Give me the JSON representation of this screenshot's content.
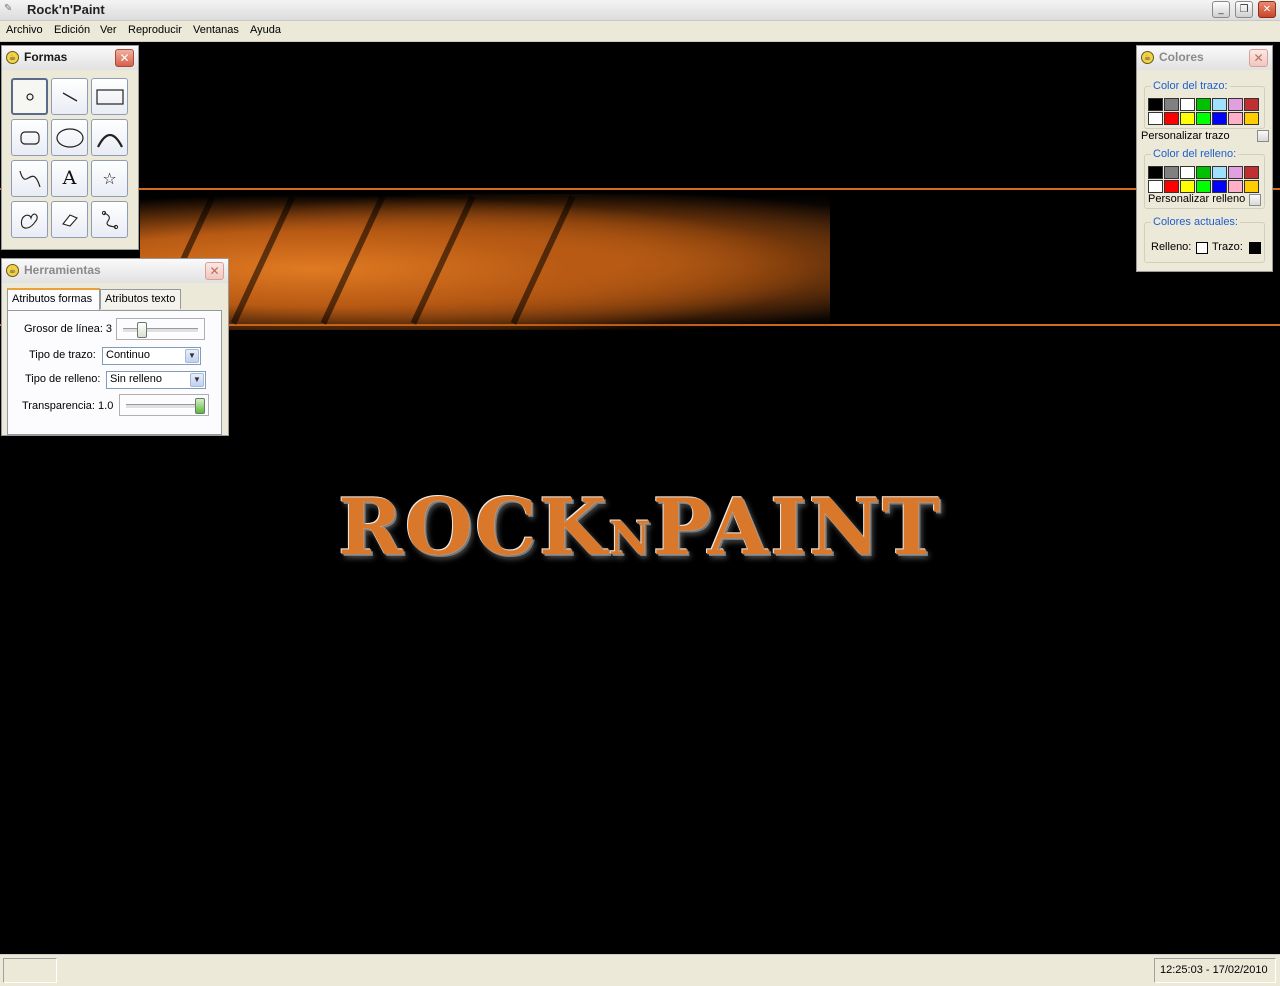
{
  "window": {
    "title": "Rock'n'Paint"
  },
  "menu": [
    "Archivo",
    "Edición",
    "Ver",
    "Reproducir",
    "Ventanas",
    "Ayuda"
  ],
  "logo": {
    "text_main_1": "ROCK",
    "text_small": "N",
    "text_main_2": "PAINT"
  },
  "formas": {
    "title": "Formas",
    "tools": [
      {
        "name": "point-tool",
        "glyph": "•"
      },
      {
        "name": "line-tool",
        "glyph": ""
      },
      {
        "name": "rectangle-tool",
        "glyph": ""
      },
      {
        "name": "rounded-rectangle-tool",
        "glyph": ""
      },
      {
        "name": "ellipse-tool",
        "glyph": ""
      },
      {
        "name": "arc-tool",
        "glyph": ""
      },
      {
        "name": "curve-tool",
        "glyph": ""
      },
      {
        "name": "text-tool",
        "glyph": "A"
      },
      {
        "name": "star-tool",
        "glyph": "☆"
      },
      {
        "name": "freeform-tool",
        "glyph": ""
      },
      {
        "name": "eraser-tool",
        "glyph": ""
      },
      {
        "name": "path-tool",
        "glyph": ""
      }
    ]
  },
  "herramientas": {
    "title": "Herramientas",
    "tabs": [
      "Atributos formas",
      "Atributos texto"
    ],
    "grosor_label": "Grosor de línea: 3",
    "grosor_value": 3,
    "tipo_trazo_label": "Tipo de trazo:",
    "tipo_trazo_value": "Continuo",
    "tipo_relleno_label": "Tipo de relleno:",
    "tipo_relleno_value": "Sin relleno",
    "transparencia_label": "Transparencia: 1.0",
    "transparencia_value": 1.0
  },
  "colores": {
    "title": "Colores",
    "trazo_group": "Color del trazo:",
    "personalizar_trazo": "Personalizar trazo",
    "relleno_group": "Color del relleno:",
    "personalizar_relleno": "Personalizar relleno",
    "actuales_group": "Colores actuales:",
    "relleno_label": "Relleno:",
    "trazo_label": "Trazo:",
    "current_relleno_color": "#ffffff",
    "current_trazo_color": "#000000",
    "palette_row1": [
      "#000000",
      "#808080",
      "#ffffff",
      "#00c000",
      "#a0e0ff",
      "#e0a0e0",
      "#c03030"
    ],
    "palette_row2": [
      "#ffffff",
      "#ff0000",
      "#ffff00",
      "#00ff00",
      "#0000ff",
      "#ffb0c8",
      "#ffcc00"
    ]
  },
  "status": {
    "left": "",
    "datetime": "12:25:03 - 17/02/2010"
  }
}
